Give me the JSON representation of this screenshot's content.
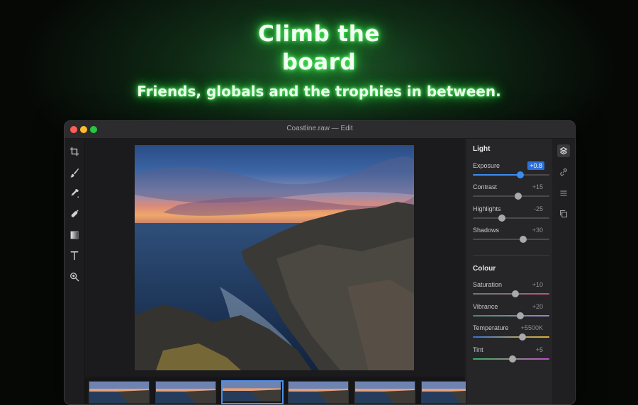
{
  "hero": {
    "title": "Climb the board",
    "subtitle": "Friends, globals and the trophies in between."
  },
  "window": {
    "title": "Coastline.raw — Edit"
  },
  "tools": [
    {
      "name": "crop-icon"
    },
    {
      "name": "brush-icon"
    },
    {
      "name": "eyedropper-icon"
    },
    {
      "name": "healing-icon"
    },
    {
      "name": "gradient-icon"
    },
    {
      "name": "text-icon"
    },
    {
      "name": "zoom-icon"
    }
  ],
  "panel": {
    "light": {
      "heading": "Light",
      "sliders": [
        {
          "label": "Exposure",
          "value": "+0.8",
          "pos": 0.62
        },
        {
          "label": "Contrast",
          "value": "+15",
          "pos": 0.59
        },
        {
          "label": "Highlights",
          "value": "-25",
          "pos": 0.38
        },
        {
          "label": "Shadows",
          "value": "+30",
          "pos": 0.66
        }
      ]
    },
    "colour": {
      "heading": "Colour",
      "sliders": [
        {
          "label": "Saturation",
          "value": "+10",
          "pos": 0.56
        },
        {
          "label": "Vibrance",
          "value": "+20",
          "pos": 0.62
        },
        {
          "label": "Temperature",
          "value": "+5500K",
          "pos": 0.65
        },
        {
          "label": "Tint",
          "value": "+5",
          "pos": 0.52
        }
      ]
    }
  },
  "rail": [
    {
      "name": "layers-icon",
      "active": true
    },
    {
      "name": "link-icon",
      "active": false
    },
    {
      "name": "list-icon",
      "active": false
    },
    {
      "name": "copy-icon",
      "active": false
    }
  ],
  "filmstrip": {
    "count": 6,
    "selected_index": 2
  },
  "colors": {
    "accent": "#3b8cf0",
    "glow": "#35e84a"
  }
}
